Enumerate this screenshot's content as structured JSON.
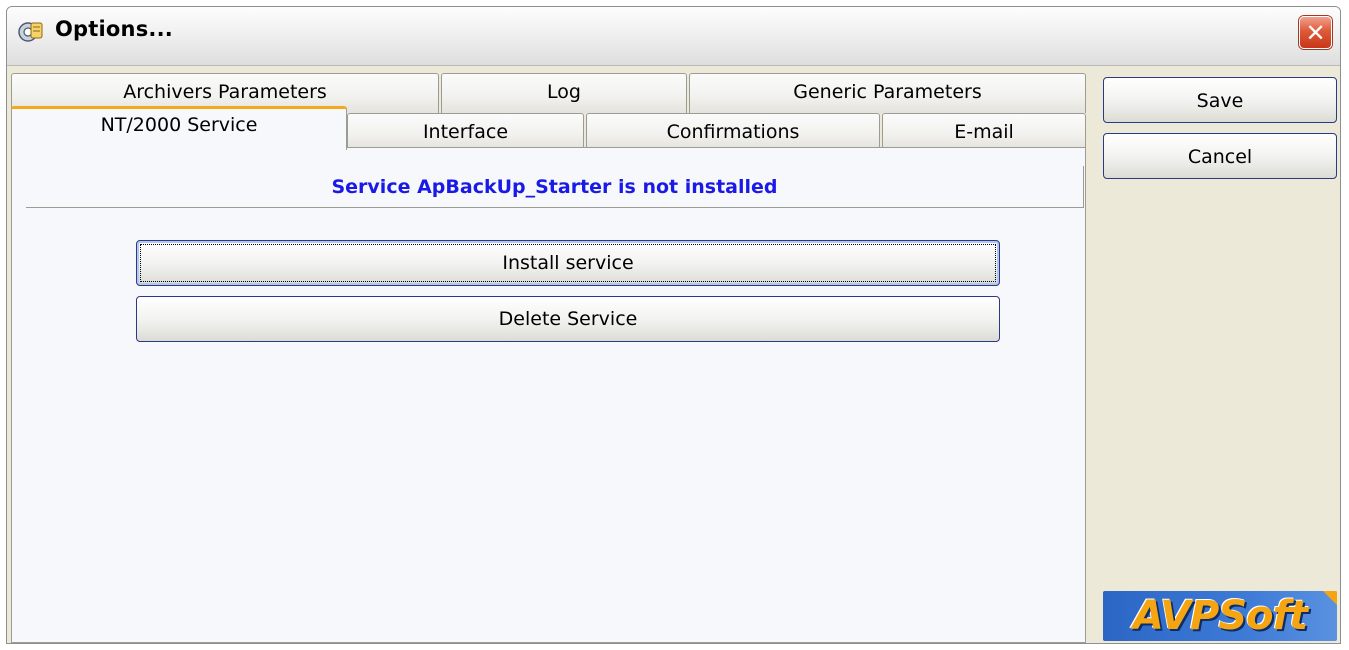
{
  "window": {
    "title": "Options...",
    "close_glyph": "✕"
  },
  "tabs": {
    "row1": [
      {
        "label": "Archivers Parameters"
      },
      {
        "label": "Log"
      },
      {
        "label": "Generic Parameters"
      }
    ],
    "row2": [
      {
        "label": "NT/2000 Service",
        "active": true
      },
      {
        "label": "Interface"
      },
      {
        "label": "Confirmations"
      },
      {
        "label": "E-mail"
      }
    ]
  },
  "service_panel": {
    "status": "Service ApBackUp_Starter is not installed",
    "install_label": "Install service",
    "delete_label": "Delete Service"
  },
  "actions": {
    "save_label": "Save",
    "cancel_label": "Cancel"
  },
  "logo": {
    "text": "AVPSoft"
  },
  "colors": {
    "status_text": "#1a1ae6",
    "active_tab_accent": "#f4a91c",
    "logo_text": "#f5a511",
    "logo_bg": "#2b66c4"
  },
  "icons": {
    "app": "options-gear-icon",
    "close": "close-icon"
  }
}
